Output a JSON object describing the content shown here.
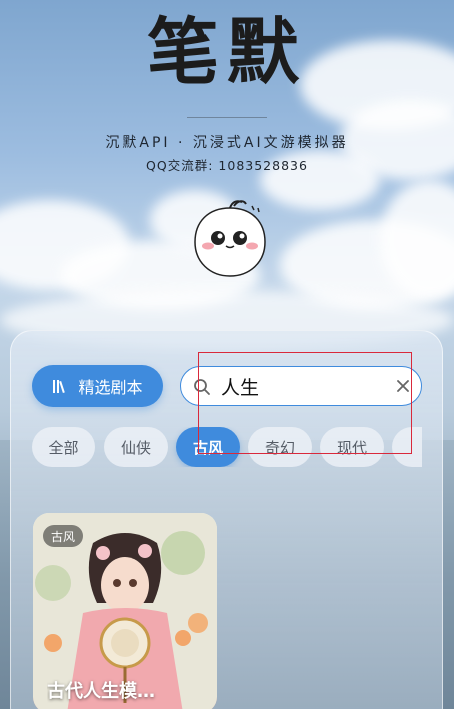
{
  "header": {
    "app_title": "笔默",
    "subtitle": "沉默API · 沉浸式AI文游模拟器",
    "qq_group": "QQ交流群: 1083528836"
  },
  "toolbar": {
    "featured_label": "精选剧本",
    "search_value": "人生"
  },
  "categories": [
    {
      "label": "全部",
      "active": false
    },
    {
      "label": "仙侠",
      "active": false
    },
    {
      "label": "古风",
      "active": true
    },
    {
      "label": "奇幻",
      "active": false
    },
    {
      "label": "现代",
      "active": false
    }
  ],
  "cards": [
    {
      "tag": "古风",
      "title": "古代人生模…"
    }
  ],
  "colors": {
    "accent": "#3f8bdd",
    "highlight": "#d9293b"
  },
  "icons": {
    "featured": "books-icon",
    "search": "search-icon",
    "clear": "close-icon"
  }
}
